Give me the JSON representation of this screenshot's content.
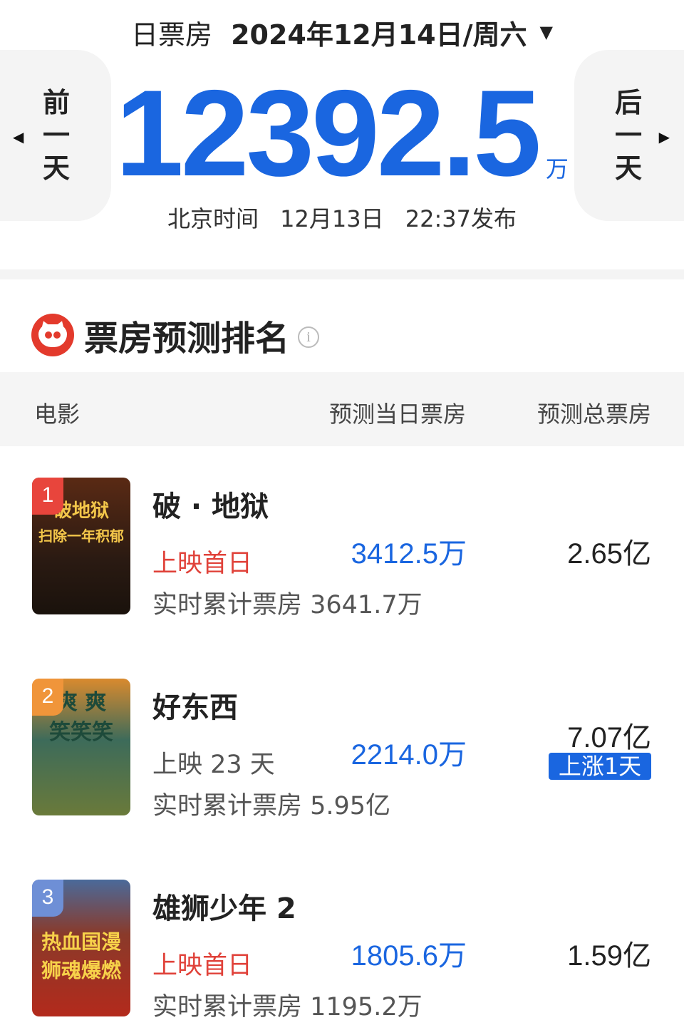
{
  "header": {
    "label": "日票房",
    "date": "2024年12月14日/周六",
    "dropdown_icon": "caret-down-icon"
  },
  "nav": {
    "prev": [
      "前",
      "一",
      "天"
    ],
    "next": [
      "后",
      "一",
      "天"
    ],
    "prev_icon": "triangle-left-icon",
    "next_icon": "triangle-right-icon"
  },
  "total": {
    "value": "12392.5",
    "unit": "万"
  },
  "publish": {
    "zone": "北京时间",
    "date": "12月13日",
    "time": "22:37发布"
  },
  "section": {
    "title": "票房预测排名",
    "logo_icon": "maoyan-cat-logo",
    "info_icon": "info-icon"
  },
  "columns": {
    "movie": "电影",
    "today": "预测当日票房",
    "total": "预测总票房"
  },
  "movies": [
    {
      "rank": "1",
      "rank_color": "#e8453c",
      "name": "破 · 地狱",
      "status": "上映首日",
      "cumulative": "实时累计票房 3641.7万",
      "today": "3412.5万",
      "total": "2.65亿",
      "badge": "",
      "poster_lines": [
        "破地狱",
        "扫除一年积郁"
      ],
      "poster_colors": [
        "#2a1a12",
        "#6b3a1c"
      ]
    },
    {
      "rank": "2",
      "rank_color": "#f0953a",
      "name": "好东西",
      "status": "上映 23 天",
      "cumulative": "实时累计票房 5.95亿",
      "today": "2214.0万",
      "total": "7.07亿",
      "badge": "上涨1天",
      "poster_lines": [
        "爽 爽",
        "笑笑笑"
      ],
      "poster_colors": [
        "#3d6b5a",
        "#d98a2e"
      ]
    },
    {
      "rank": "3",
      "rank_color": "#6e8fd6",
      "name": "雄狮少年 2",
      "status": "上映首日",
      "cumulative": "实时累计票房 1195.2万",
      "today": "1805.6万",
      "total": "1.59亿",
      "badge": "",
      "poster_lines": [
        "热血国漫",
        "狮魂爆燃"
      ],
      "poster_colors": [
        "#4a6a9a",
        "#b32a1c"
      ]
    }
  ]
}
